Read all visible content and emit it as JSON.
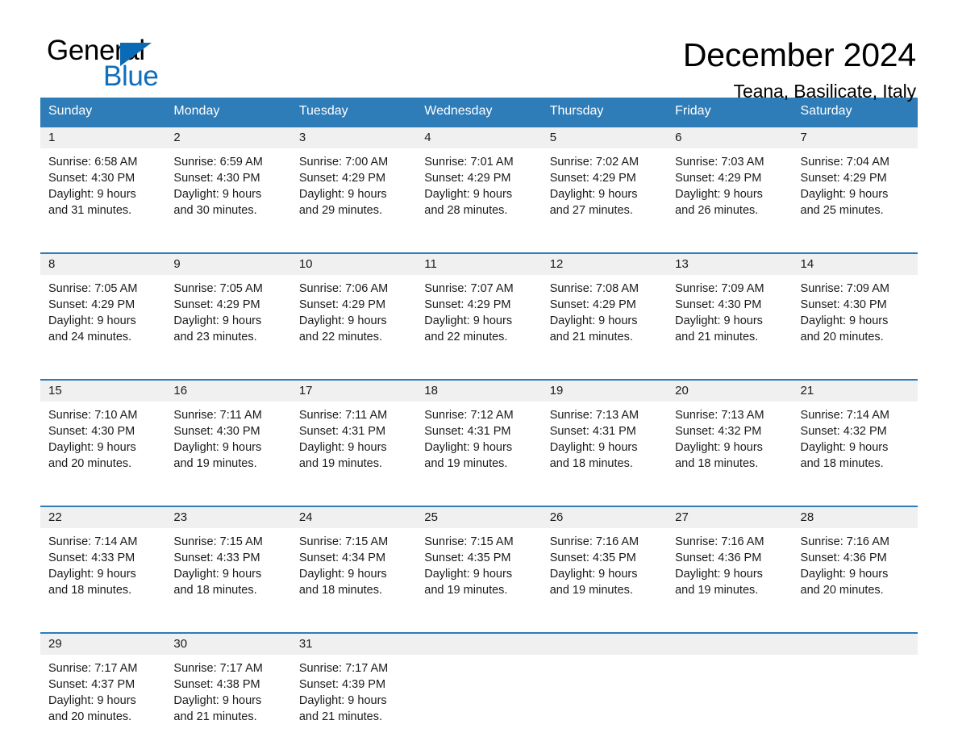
{
  "logo": {
    "word_one": "General",
    "word_two": "Blue",
    "triangle_color": "#0a6ab5",
    "blue_text_color": "#0f6ebd"
  },
  "header": {
    "title": "December 2024",
    "location": "Teana, Basilicate, Italy"
  },
  "theme": {
    "header_blue": "#2e7cb8",
    "row_line_blue": "#2e7cb8",
    "daynum_band": "#f0f0f0",
    "text": "#1a1a1a"
  },
  "weekday_headers": [
    "Sunday",
    "Monday",
    "Tuesday",
    "Wednesday",
    "Thursday",
    "Friday",
    "Saturday"
  ],
  "weeks": [
    [
      {
        "day": "1",
        "sunrise": "Sunrise: 6:58 AM",
        "sunset": "Sunset: 4:30 PM",
        "daylight": "Daylight: 9 hours\nand 31 minutes."
      },
      {
        "day": "2",
        "sunrise": "Sunrise: 6:59 AM",
        "sunset": "Sunset: 4:30 PM",
        "daylight": "Daylight: 9 hours\nand 30 minutes."
      },
      {
        "day": "3",
        "sunrise": "Sunrise: 7:00 AM",
        "sunset": "Sunset: 4:29 PM",
        "daylight": "Daylight: 9 hours\nand 29 minutes."
      },
      {
        "day": "4",
        "sunrise": "Sunrise: 7:01 AM",
        "sunset": "Sunset: 4:29 PM",
        "daylight": "Daylight: 9 hours\nand 28 minutes."
      },
      {
        "day": "5",
        "sunrise": "Sunrise: 7:02 AM",
        "sunset": "Sunset: 4:29 PM",
        "daylight": "Daylight: 9 hours\nand 27 minutes."
      },
      {
        "day": "6",
        "sunrise": "Sunrise: 7:03 AM",
        "sunset": "Sunset: 4:29 PM",
        "daylight": "Daylight: 9 hours\nand 26 minutes."
      },
      {
        "day": "7",
        "sunrise": "Sunrise: 7:04 AM",
        "sunset": "Sunset: 4:29 PM",
        "daylight": "Daylight: 9 hours\nand 25 minutes."
      }
    ],
    [
      {
        "day": "8",
        "sunrise": "Sunrise: 7:05 AM",
        "sunset": "Sunset: 4:29 PM",
        "daylight": "Daylight: 9 hours\nand 24 minutes."
      },
      {
        "day": "9",
        "sunrise": "Sunrise: 7:05 AM",
        "sunset": "Sunset: 4:29 PM",
        "daylight": "Daylight: 9 hours\nand 23 minutes."
      },
      {
        "day": "10",
        "sunrise": "Sunrise: 7:06 AM",
        "sunset": "Sunset: 4:29 PM",
        "daylight": "Daylight: 9 hours\nand 22 minutes."
      },
      {
        "day": "11",
        "sunrise": "Sunrise: 7:07 AM",
        "sunset": "Sunset: 4:29 PM",
        "daylight": "Daylight: 9 hours\nand 22 minutes."
      },
      {
        "day": "12",
        "sunrise": "Sunrise: 7:08 AM",
        "sunset": "Sunset: 4:29 PM",
        "daylight": "Daylight: 9 hours\nand 21 minutes."
      },
      {
        "day": "13",
        "sunrise": "Sunrise: 7:09 AM",
        "sunset": "Sunset: 4:30 PM",
        "daylight": "Daylight: 9 hours\nand 21 minutes."
      },
      {
        "day": "14",
        "sunrise": "Sunrise: 7:09 AM",
        "sunset": "Sunset: 4:30 PM",
        "daylight": "Daylight: 9 hours\nand 20 minutes."
      }
    ],
    [
      {
        "day": "15",
        "sunrise": "Sunrise: 7:10 AM",
        "sunset": "Sunset: 4:30 PM",
        "daylight": "Daylight: 9 hours\nand 20 minutes."
      },
      {
        "day": "16",
        "sunrise": "Sunrise: 7:11 AM",
        "sunset": "Sunset: 4:30 PM",
        "daylight": "Daylight: 9 hours\nand 19 minutes."
      },
      {
        "day": "17",
        "sunrise": "Sunrise: 7:11 AM",
        "sunset": "Sunset: 4:31 PM",
        "daylight": "Daylight: 9 hours\nand 19 minutes."
      },
      {
        "day": "18",
        "sunrise": "Sunrise: 7:12 AM",
        "sunset": "Sunset: 4:31 PM",
        "daylight": "Daylight: 9 hours\nand 19 minutes."
      },
      {
        "day": "19",
        "sunrise": "Sunrise: 7:13 AM",
        "sunset": "Sunset: 4:31 PM",
        "daylight": "Daylight: 9 hours\nand 18 minutes."
      },
      {
        "day": "20",
        "sunrise": "Sunrise: 7:13 AM",
        "sunset": "Sunset: 4:32 PM",
        "daylight": "Daylight: 9 hours\nand 18 minutes."
      },
      {
        "day": "21",
        "sunrise": "Sunrise: 7:14 AM",
        "sunset": "Sunset: 4:32 PM",
        "daylight": "Daylight: 9 hours\nand 18 minutes."
      }
    ],
    [
      {
        "day": "22",
        "sunrise": "Sunrise: 7:14 AM",
        "sunset": "Sunset: 4:33 PM",
        "daylight": "Daylight: 9 hours\nand 18 minutes."
      },
      {
        "day": "23",
        "sunrise": "Sunrise: 7:15 AM",
        "sunset": "Sunset: 4:33 PM",
        "daylight": "Daylight: 9 hours\nand 18 minutes."
      },
      {
        "day": "24",
        "sunrise": "Sunrise: 7:15 AM",
        "sunset": "Sunset: 4:34 PM",
        "daylight": "Daylight: 9 hours\nand 18 minutes."
      },
      {
        "day": "25",
        "sunrise": "Sunrise: 7:15 AM",
        "sunset": "Sunset: 4:35 PM",
        "daylight": "Daylight: 9 hours\nand 19 minutes."
      },
      {
        "day": "26",
        "sunrise": "Sunrise: 7:16 AM",
        "sunset": "Sunset: 4:35 PM",
        "daylight": "Daylight: 9 hours\nand 19 minutes."
      },
      {
        "day": "27",
        "sunrise": "Sunrise: 7:16 AM",
        "sunset": "Sunset: 4:36 PM",
        "daylight": "Daylight: 9 hours\nand 19 minutes."
      },
      {
        "day": "28",
        "sunrise": "Sunrise: 7:16 AM",
        "sunset": "Sunset: 4:36 PM",
        "daylight": "Daylight: 9 hours\nand 20 minutes."
      }
    ],
    [
      {
        "day": "29",
        "sunrise": "Sunrise: 7:17 AM",
        "sunset": "Sunset: 4:37 PM",
        "daylight": "Daylight: 9 hours\nand 20 minutes."
      },
      {
        "day": "30",
        "sunrise": "Sunrise: 7:17 AM",
        "sunset": "Sunset: 4:38 PM",
        "daylight": "Daylight: 9 hours\nand 21 minutes."
      },
      {
        "day": "31",
        "sunrise": "Sunrise: 7:17 AM",
        "sunset": "Sunset: 4:39 PM",
        "daylight": "Daylight: 9 hours\nand 21 minutes."
      },
      {
        "day": "",
        "sunrise": "",
        "sunset": "",
        "daylight": ""
      },
      {
        "day": "",
        "sunrise": "",
        "sunset": "",
        "daylight": ""
      },
      {
        "day": "",
        "sunrise": "",
        "sunset": "",
        "daylight": ""
      },
      {
        "day": "",
        "sunrise": "",
        "sunset": "",
        "daylight": ""
      }
    ]
  ]
}
